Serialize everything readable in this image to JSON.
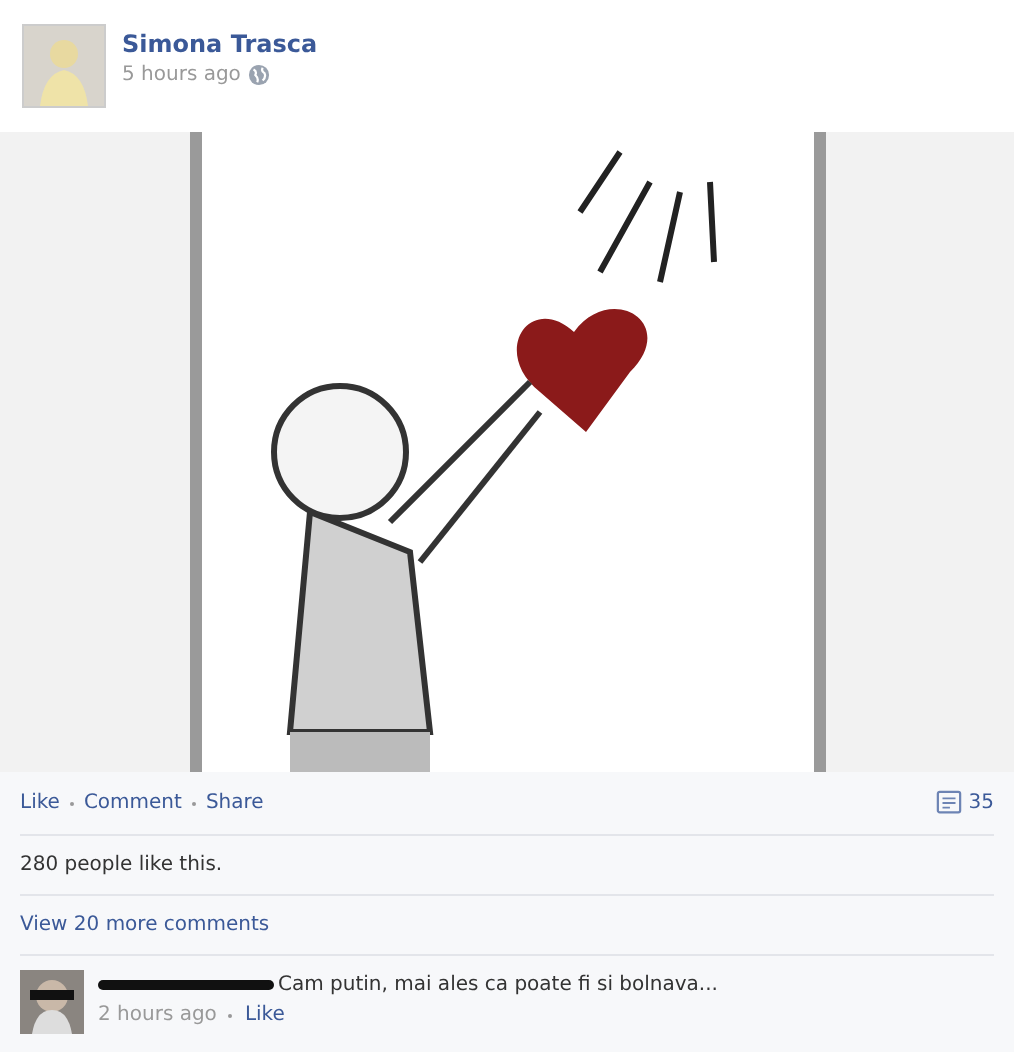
{
  "post": {
    "author": "Simona Trasca",
    "time": "5 hours ago"
  },
  "actions": [
    "Like",
    "Comment",
    "Share"
  ],
  "comment_count": "35",
  "likes": "280 people like this.",
  "view_more": "View 20 more comments",
  "comments": [
    {
      "author_redacted": true,
      "text": "Cam putin, mai ales ca poate fi si bolnava...",
      "time": "2 hours ago",
      "action": "Like"
    }
  ]
}
